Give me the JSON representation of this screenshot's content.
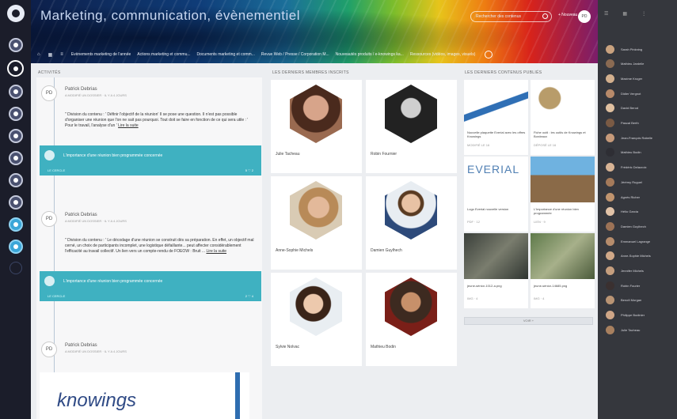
{
  "header": {
    "title": "Marketing, communication, évènementiel",
    "search_placeholder": "Rechercher des contenus",
    "new_label": "+ Nouveau",
    "user_initials": "PD"
  },
  "nav": {
    "home_icons": [
      "⌂",
      "▦",
      "≡"
    ],
    "tabs": [
      "Evènements marketing de l'année",
      "Actions marketing et commu...",
      "Documents marketing et comm...",
      "Revue Web / Presse / Corporation M...",
      "Nouveautés produits / e-knowings ka...",
      "Ressources (vidéos, images, visuels)"
    ]
  },
  "activity": {
    "header": "ACTIVITÉS",
    "items": [
      {
        "initials": "PD",
        "name": "Patrick Debrias",
        "meta": "A MODIFIÉ UN DOSSIER · IL Y A 4 JOURS",
        "quote": "\" Division du contenu : ' Définir l'objectif de la réunion' Il se pose une question. Il n'est pas possible d'organiser une réunion que l'on ne sait pas pourquoi. Tout doit se faire en fonction de ce qui sera utile : ' Pour le travail, l'analyse d'un '",
        "link": "Lire la suite",
        "bar_text": "L'importance d'une réunion bien programmée concernée",
        "bar_tag": "LE CERCLE",
        "bar_stat": "5 ♡ 2"
      },
      {
        "initials": "PD",
        "name": "Patrick Debrias",
        "meta": "A MODIFIÉ UN DOSSIER · IL Y A 4 JOURS",
        "quote": "\" Division du contenu : ' Le décodage d'une réunion se construit dès sa préparation. En effet, un objectif mal cerné, un choix de participants incomplet, une logistique défaillante... peut affecter considérablement l'efficacité au travail collectif. Un lien vers un compte-rendu de FOEOW : Bruit ...",
        "link": "Lire la suite",
        "bar_text": "L'importance d'une réunion bien programmée concernée",
        "bar_tag": "LE CERCLE",
        "bar_stat": "2 ♡ 4"
      },
      {
        "initials": "PD",
        "name": "Patrick Debrias",
        "meta": "A MODIFIÉ UN DOSSIER · IL Y A 4 JOURS"
      }
    ],
    "logo_text": "knowings"
  },
  "members": {
    "header": "LES DERNIERS MEMBRES INSCRITS",
    "items": [
      {
        "name": "Julie Tacheau"
      },
      {
        "name": "Robin Fournier"
      },
      {
        "name": "Anne-Sophie Michels"
      },
      {
        "name": "Damien Guylhech"
      },
      {
        "name": "Sylvie Nolvac"
      },
      {
        "name": "Mathieu Bodin"
      }
    ]
  },
  "content": {
    "header": "LES DERNIERS CONTENUS PUBLIÉS",
    "cards": [
      {
        "title": "Nouvelle plaquette Everial avec les offres Knowings",
        "meta": "MODIFIÉ LE 16"
      },
      {
        "title": "Fiche outil : les outils de Knowings et Bordeaux",
        "meta": "DÉPOSÉ LE 16"
      },
      {
        "title": "Logo Everial nouvelle version",
        "meta": "PDF · 12"
      },
      {
        "title": "L'Importance d'une réunion bien programmée",
        "meta": "LIEN · 9"
      },
      {
        "title": "jeune-sénior-1012-a.png",
        "meta": "IMG · 4"
      },
      {
        "title": "jeune-sénior-14685.png",
        "meta": "IMG · 4"
      }
    ],
    "more": "VOIR +"
  },
  "sidebar": {
    "top_icons": [
      "☰",
      "▦",
      "⋮"
    ],
    "contacts": [
      "Sarah Pinkning",
      "Mathieu Jardelle",
      "Maxime Kroger",
      "Didier Vergnot",
      "David Berod",
      "Pascal Berth",
      "Jean-François Rabelle",
      "Mathieu Bodin",
      "Frédéric Delacroix",
      "Jérémy Ruguel",
      "Agnès Richer",
      "Hélio Garcia",
      "Damien Guylhech",
      "Emmanuel Lagrange",
      "Anne-Sophie Michels",
      "Jennifer Michels",
      "Robin Fourier",
      "Benoît Morgan",
      "Philippe Bodinier",
      "Julie Tacheau"
    ]
  }
}
